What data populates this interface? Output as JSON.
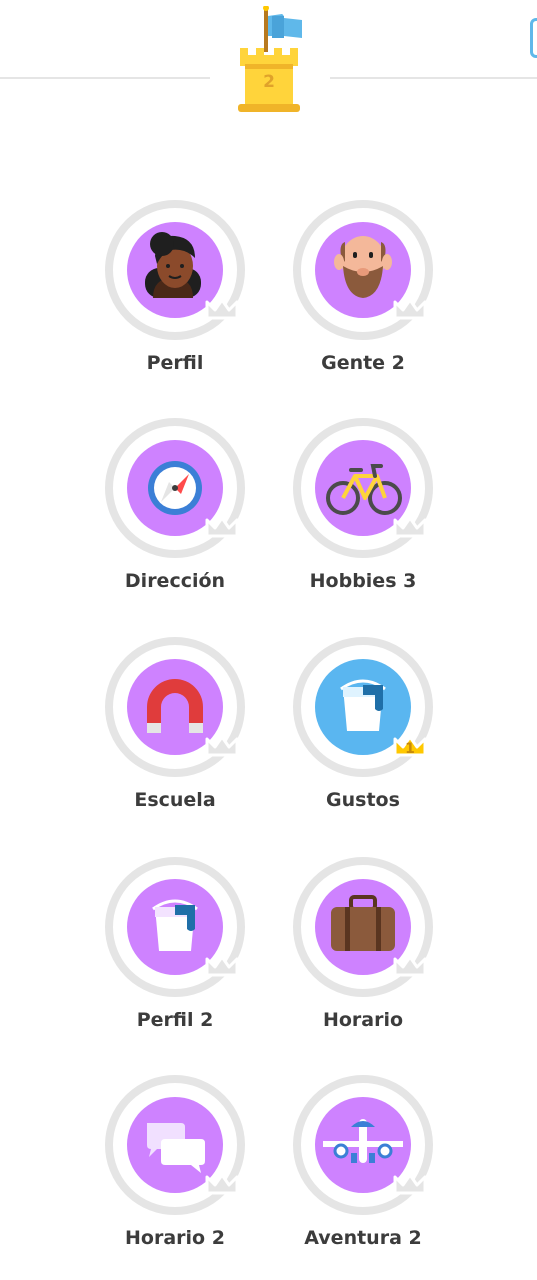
{
  "checkpoint": {
    "number": "2",
    "icon": "castle-checkpoint-icon",
    "colors": {
      "castle": "#ffd43b",
      "flag": "#5fb8ea"
    }
  },
  "skills": [
    {
      "id": "perfil",
      "label": "Perfil",
      "icon": "woman-face-icon",
      "color": "#ce82ff",
      "crown_level": null
    },
    {
      "id": "gente-2",
      "label": "Gente 2",
      "icon": "bald-man-face-icon",
      "color": "#ce82ff",
      "crown_level": null
    },
    {
      "id": "direccion",
      "label": "Dirección",
      "icon": "compass-icon",
      "color": "#ce82ff",
      "crown_level": null
    },
    {
      "id": "hobbies-3",
      "label": "Hobbies 3",
      "icon": "bicycle-icon",
      "color": "#ce82ff",
      "crown_level": null
    },
    {
      "id": "escuela",
      "label": "Escuela",
      "icon": "magnet-icon",
      "color": "#ce82ff",
      "crown_level": null
    },
    {
      "id": "gustos",
      "label": "Gustos",
      "icon": "paint-bucket-icon",
      "color": "#5ab6f0",
      "crown_level": "1"
    },
    {
      "id": "perfil-2",
      "label": "Perfil 2",
      "icon": "paint-bucket-icon",
      "color": "#ce82ff",
      "crown_level": null
    },
    {
      "id": "horario",
      "label": "Horario",
      "icon": "suitcase-icon",
      "color": "#ce82ff",
      "crown_level": null
    },
    {
      "id": "horario-2",
      "label": "Horario 2",
      "icon": "speech-bubbles-icon",
      "color": "#ce82ff",
      "crown_level": null
    },
    {
      "id": "aventura-2",
      "label": "Aventura 2",
      "icon": "airplane-icon",
      "color": "#ce82ff",
      "crown_level": null
    }
  ],
  "colors": {
    "ring": "#e5e5e5",
    "crown_locked": "#e5e5e5",
    "crown_gold": "#ffc800",
    "label": "#3c3c3c"
  }
}
